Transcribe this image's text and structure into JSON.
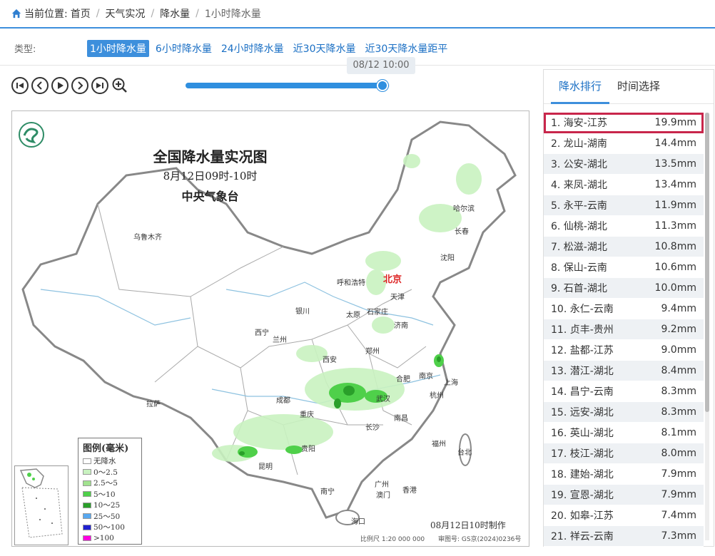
{
  "breadcrumb": {
    "label": "当前位置:",
    "items": [
      "首页",
      "天气实况",
      "降水量",
      "1小时降水量"
    ]
  },
  "typebar": {
    "label": "类型:",
    "options": [
      "1小时降水量",
      "6小时降水量",
      "24小时降水量",
      "近30天降水量",
      "近30天降水量距平"
    ],
    "active_index": 0
  },
  "slider": {
    "tooltip": "08/12 10:00",
    "progress": 0.965
  },
  "controls": [
    "first-icon",
    "prev-icon",
    "play-icon",
    "next-icon",
    "last-icon",
    "zoom-in-icon"
  ],
  "map": {
    "title": "全国降水量实况图",
    "subtitle": "8月12日09时-10时",
    "agency": "中央气象台",
    "cities": [
      "乌鲁木齐",
      "哈尔滨",
      "长春",
      "沈阳",
      "呼和浩特",
      "北京",
      "天津",
      "银川",
      "太原",
      "石家庄",
      "西宁",
      "兰州",
      "济南",
      "郑州",
      "西安",
      "南京",
      "合肥",
      "上海",
      "杭州",
      "武汉",
      "成都",
      "重庆",
      "拉萨",
      "长沙",
      "南昌",
      "贵阳",
      "福州",
      "台北",
      "昆明",
      "南宁",
      "广州",
      "澳门",
      "香港",
      "海口"
    ],
    "legend_title": "图例(毫米)",
    "legend": [
      {
        "label": "无降水",
        "color": "#ffffff"
      },
      {
        "label": "0～2.5",
        "color": "#c9f2c0"
      },
      {
        "label": "2.5～5",
        "color": "#a2e28f"
      },
      {
        "label": "5～10",
        "color": "#4fd04a"
      },
      {
        "label": "10～25",
        "color": "#2a9f2a"
      },
      {
        "label": "25～50",
        "color": "#58a8f0"
      },
      {
        "label": "50～100",
        "color": "#2020d0"
      },
      {
        "label": ">100",
        "color": "#ff00e0"
      }
    ],
    "made_time": "08月12日10时制作",
    "scale": "比例尺  1:20 000 000",
    "review_no": "审图号: GS京(2024)0236号"
  },
  "panel": {
    "tabs": [
      "降水排行",
      "时间选择"
    ],
    "ranking": [
      {
        "name": "1. 海安-江苏",
        "value": "19.9mm"
      },
      {
        "name": "2. 龙山-湖南",
        "value": "14.4mm"
      },
      {
        "name": "3. 公安-湖北",
        "value": "13.5mm"
      },
      {
        "name": "4. 来凤-湖北",
        "value": "13.4mm"
      },
      {
        "name": "5. 永平-云南",
        "value": "11.9mm"
      },
      {
        "name": "6. 仙桃-湖北",
        "value": "11.3mm"
      },
      {
        "name": "7. 松滋-湖北",
        "value": "10.8mm"
      },
      {
        "name": "8. 保山-云南",
        "value": "10.6mm"
      },
      {
        "name": "9. 石首-湖北",
        "value": "10.0mm"
      },
      {
        "name": "10. 永仁-云南",
        "value": "9.4mm"
      },
      {
        "name": "11. 贞丰-贵州",
        "value": "9.2mm"
      },
      {
        "name": "12. 盐都-江苏",
        "value": "9.0mm"
      },
      {
        "name": "13. 潜江-湖北",
        "value": "8.4mm"
      },
      {
        "name": "14. 昌宁-云南",
        "value": "8.3mm"
      },
      {
        "name": "15. 远安-湖北",
        "value": "8.3mm"
      },
      {
        "name": "16. 英山-湖北",
        "value": "8.1mm"
      },
      {
        "name": "17. 枝江-湖北",
        "value": "8.0mm"
      },
      {
        "name": "18. 建始-湖北",
        "value": "7.9mm"
      },
      {
        "name": "19. 宣恩-湖北",
        "value": "7.9mm"
      },
      {
        "name": "20. 如皋-江苏",
        "value": "7.4mm"
      },
      {
        "name": "21. 祥云-云南",
        "value": "7.3mm"
      }
    ],
    "highlight_index": 0
  }
}
